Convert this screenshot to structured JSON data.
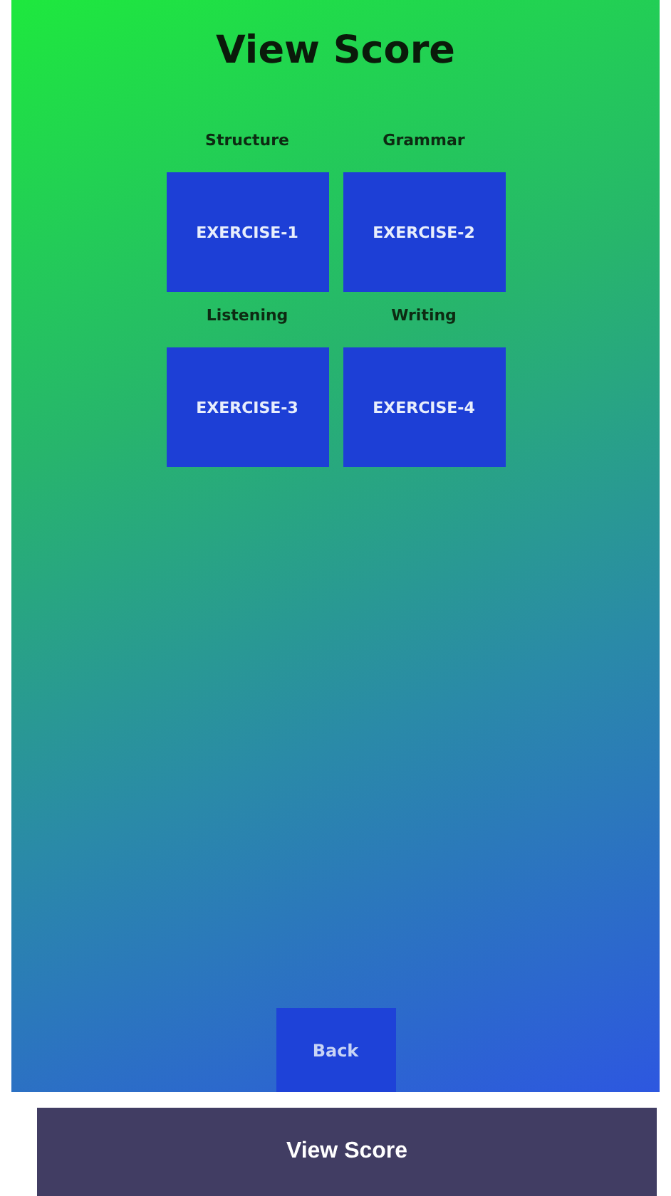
{
  "screen": {
    "title": "View Score",
    "exercises": [
      {
        "category": "Structure",
        "button": "EXERCISE-1"
      },
      {
        "category": "Grammar",
        "button": "EXERCISE-2"
      },
      {
        "category": "Listening",
        "button": "EXERCISE-3"
      },
      {
        "category": "Writing",
        "button": "EXERCISE-4"
      }
    ],
    "back_button": "Back"
  },
  "caption": "View Score"
}
